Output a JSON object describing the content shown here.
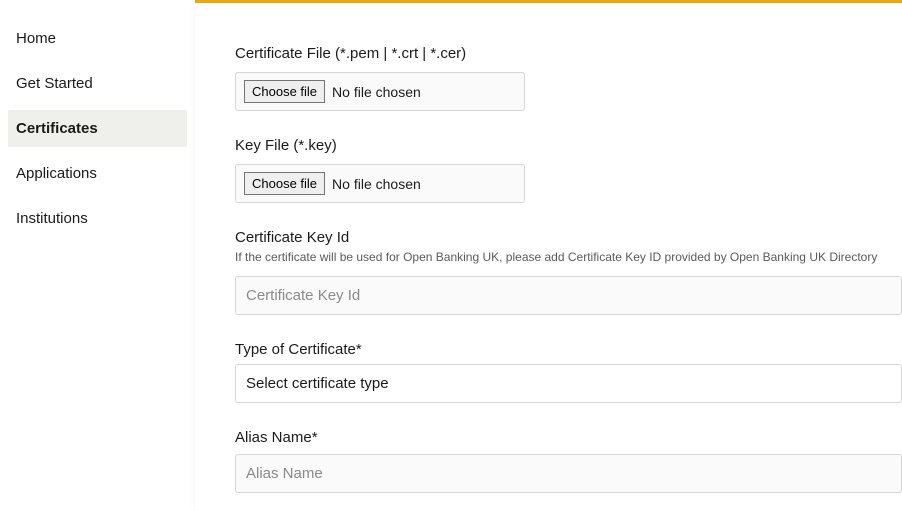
{
  "sidebar": {
    "items": [
      {
        "label": "Home",
        "active": false
      },
      {
        "label": "Get Started",
        "active": false
      },
      {
        "label": "Certificates",
        "active": true
      },
      {
        "label": "Applications",
        "active": false
      },
      {
        "label": "Institutions",
        "active": false
      }
    ]
  },
  "form": {
    "cert_file": {
      "label": "Certificate File (*.pem | *.crt | *.cer)",
      "button": "Choose file",
      "status": "No file chosen"
    },
    "key_file": {
      "label": "Key File (*.key)",
      "button": "Choose file",
      "status": "No file chosen"
    },
    "cert_key_id": {
      "label": "Certificate Key Id",
      "hint": "If the certificate will be used for Open Banking UK, please add Certificate Key ID provided by Open Banking UK Directory",
      "placeholder": "Certificate Key Id"
    },
    "cert_type": {
      "label": "Type of Certificate*",
      "selected": "Select certificate type"
    },
    "alias_name": {
      "label": "Alias Name*",
      "placeholder": "Alias Name"
    }
  }
}
